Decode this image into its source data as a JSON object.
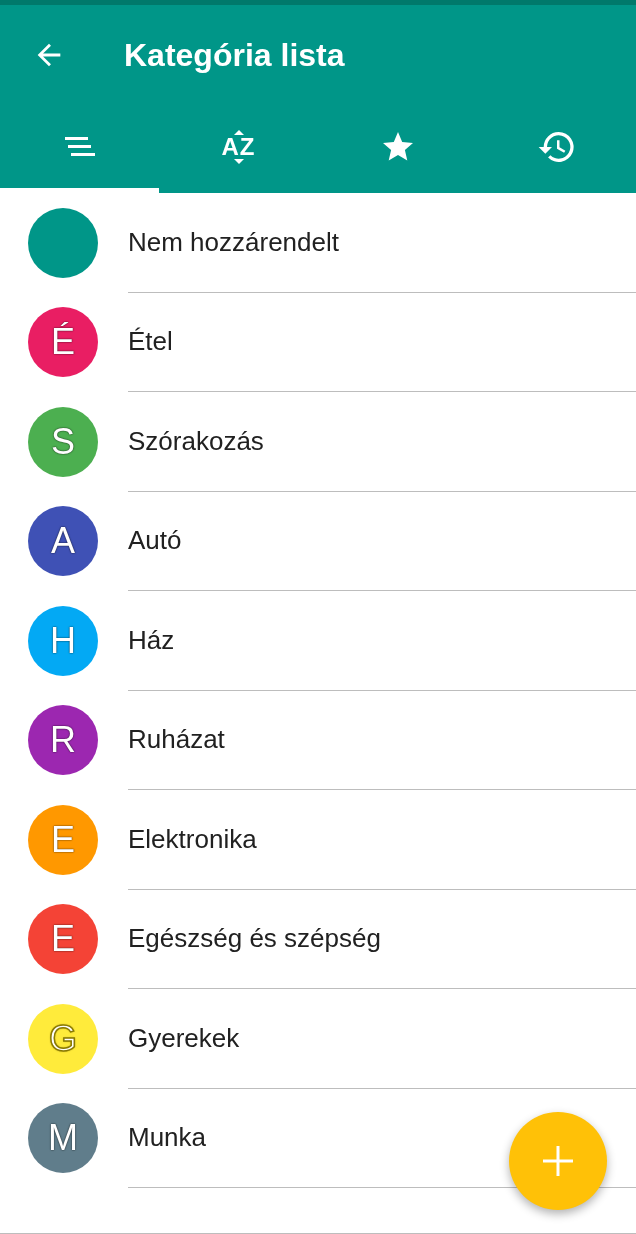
{
  "app_bar": {
    "title": "Kategória lista"
  },
  "tabs": [
    {
      "kind": "list",
      "selected": true
    },
    {
      "kind": "sort",
      "label": "AZ",
      "selected": false
    },
    {
      "kind": "star",
      "selected": false
    },
    {
      "kind": "history",
      "selected": false
    }
  ],
  "categories": [
    {
      "name": "Nem hozzárendelt",
      "color": "#009688"
    },
    {
      "letter": "É",
      "name": "Étel",
      "color": "#e91e63"
    },
    {
      "letter": "S",
      "name": "Szórakozás",
      "color": "#4caf50"
    },
    {
      "letter": "A",
      "name": "Autó",
      "color": "#3f51b5"
    },
    {
      "letter": "H",
      "name": "Ház",
      "color": "#03a9f4"
    },
    {
      "letter": "R",
      "name": "Ruházat",
      "color": "#9c27b0"
    },
    {
      "letter": "E",
      "name": "Elektronika",
      "color": "#ff9800"
    },
    {
      "letter": "E",
      "name": "Egészség és szépség",
      "color": "#f44336"
    },
    {
      "letter": "G",
      "name": "Gyerekek",
      "color": "#ffeb3b"
    },
    {
      "letter": "M",
      "name": "Munka",
      "color": "#607d8b"
    }
  ],
  "fab": {
    "kind": "add"
  }
}
